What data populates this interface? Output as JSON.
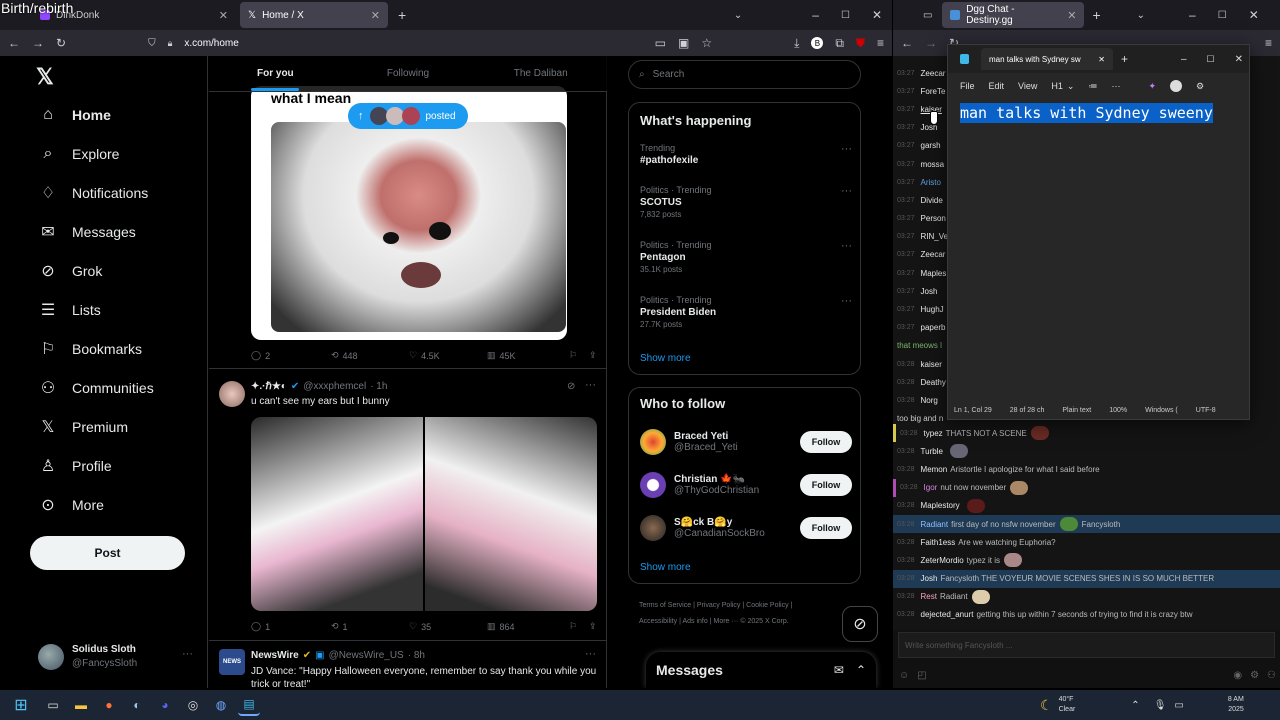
{
  "overlay_text": "Birth/rebirth",
  "browser_left": {
    "tabs": [
      {
        "label": "DinkDonk"
      },
      {
        "label": "Home / X"
      }
    ],
    "url": "x.com/home"
  },
  "x_sidebar": {
    "items": [
      {
        "label": "Home",
        "icon": "home-icon"
      },
      {
        "label": "Explore",
        "icon": "search-icon"
      },
      {
        "label": "Notifications",
        "icon": "bell-icon"
      },
      {
        "label": "Messages",
        "icon": "mail-icon"
      },
      {
        "label": "Grok",
        "icon": "grok-icon"
      },
      {
        "label": "Lists",
        "icon": "list-icon"
      },
      {
        "label": "Bookmarks",
        "icon": "bookmark-icon"
      },
      {
        "label": "Communities",
        "icon": "people-icon"
      },
      {
        "label": "Premium",
        "icon": "x-icon"
      },
      {
        "label": "Profile",
        "icon": "person-icon"
      },
      {
        "label": "More",
        "icon": "more-icon"
      }
    ],
    "post_label": "Post",
    "account": {
      "name": "Solidus Sloth",
      "handle": "@FancysSloth"
    }
  },
  "feed": {
    "tabs": [
      "For you",
      "Following",
      "The Daliban"
    ],
    "new_posts_label": "posted",
    "post1": {
      "caption": "what I mean",
      "stats": {
        "replies": "2",
        "reposts": "448",
        "likes": "4.5K",
        "views": "45K"
      }
    },
    "post2": {
      "name": "✦.·ℏ★◐",
      "handle": "@xxxphemcel",
      "time": "· 1h",
      "text": "u can't see my ears but I bunny",
      "stats": {
        "replies": "1",
        "reposts": "1",
        "likes": "35",
        "views": "864"
      }
    },
    "post3": {
      "name": "NewsWire",
      "handle": "@NewsWire_US",
      "time": "· 8h",
      "text": "JD Vance: \"Happy Halloween everyone, remember to say thank you while you trick or treat!\""
    }
  },
  "right_column": {
    "search_placeholder": "Search",
    "happening_title": "What's happening",
    "trends": [
      {
        "meta": "Trending",
        "name": "#pathofexile",
        "posts": ""
      },
      {
        "meta": "Politics · Trending",
        "name": "SCOTUS",
        "posts": "7,832 posts"
      },
      {
        "meta": "Politics · Trending",
        "name": "Pentagon",
        "posts": "35.1K posts"
      },
      {
        "meta": "Politics · Trending",
        "name": "President Biden",
        "posts": "27.7K posts"
      }
    ],
    "show_more": "Show more",
    "wtf_title": "Who to follow",
    "wtf": [
      {
        "name": "Braced Yeti",
        "handle": "@Braced_Yeti"
      },
      {
        "name": "Christian 🍁🐜",
        "handle": "@ThyGodChristian"
      },
      {
        "name": "S🤗ck B🤗y",
        "handle": "@CanadianSockBro"
      }
    ],
    "follow_label": "Follow",
    "footer": [
      "Terms of Service",
      "Privacy Policy",
      "Cookie Policy",
      "Accessibility",
      "Ads info",
      "More ···",
      "© 2025 X Corp."
    ],
    "messages_label": "Messages"
  },
  "browser_right": {
    "tab": "Dgg Chat - Destiny.gg"
  },
  "chat": {
    "top_lines": [
      {
        "time": "03:27",
        "user": "Zeecar"
      },
      {
        "time": "03:27",
        "user": "ForeTe"
      },
      {
        "time": "03:27",
        "user": "kaiser"
      },
      {
        "time": "03:27",
        "user": "Josh"
      },
      {
        "time": "03:27",
        "user": "garsh"
      },
      {
        "time": "03:27",
        "user": "mossa"
      },
      {
        "time": "03:27",
        "user": "Aristo"
      },
      {
        "time": "03:27",
        "user": "Divide"
      },
      {
        "time": "03:27",
        "user": "Person"
      },
      {
        "time": "03:27",
        "user": "RIN_Ve"
      },
      {
        "time": "03:27",
        "user": "Zeecar"
      },
      {
        "time": "03:27",
        "user": "Maples"
      },
      {
        "time": "03:27",
        "user": "Josh"
      },
      {
        "time": "03:27",
        "user": "HughJ"
      },
      {
        "time": "03:27",
        "user": "paperb"
      }
    ],
    "meows_fragment": "that meows l",
    "mid_lines": [
      {
        "time": "03:28",
        "user": "kaiser"
      },
      {
        "time": "03:28",
        "user": "Deathy"
      },
      {
        "time": "03:28",
        "user": "Norg"
      }
    ],
    "bigmid_fragment": "too big and n",
    "lines": [
      {
        "time": "03:28",
        "user": "typez",
        "msg": "THATS NOT A SCENE"
      },
      {
        "time": "03:28",
        "user": "Turble",
        "msg": ""
      },
      {
        "time": "03:28",
        "user": "Memon",
        "msg": "Aristortle I apologize for what I said before"
      },
      {
        "time": "03:28",
        "user": "Igor",
        "msg": "nut now november"
      },
      {
        "time": "03:28",
        "user": "Maplestory",
        "msg": ""
      },
      {
        "time": "03:28",
        "user": "Radiant",
        "msg": "first day of no nsfw november",
        "extra": "Fancysloth"
      },
      {
        "time": "03:28",
        "user": "Faith1ess",
        "msg": "Are we watching Euphoria?"
      },
      {
        "time": "03:28",
        "user": "ZeterMordio",
        "msg": "typez it is"
      },
      {
        "time": "03:28",
        "user": "Josh",
        "msg": "Fancysloth THE VOYEUR MOVIE SCENES SHES IN IS SO MUCH BETTER"
      },
      {
        "time": "03:28",
        "user": "Rest",
        "msg": "Radiant"
      },
      {
        "time": "03:28",
        "user": "dejected_anurt",
        "msg": "getting this up within 7 seconds of trying to find it is crazy btw"
      }
    ],
    "input_placeholder": "Write something Fancysloth ..."
  },
  "notepad": {
    "tab_title": "man talks with Sydney sw",
    "menu": [
      "File",
      "Edit",
      "View"
    ],
    "heading_select": "H1",
    "content": "man talks with Sydney sweeny",
    "status": [
      "Ln 1, Col 29",
      "28 of 28 ch",
      "Plain text",
      "100%",
      "Windows (",
      "UTF-8"
    ]
  },
  "taskbar": {
    "weather_temp": "40°F",
    "weather_desc": "Clear",
    "time": "8 AM",
    "date": "2025"
  }
}
